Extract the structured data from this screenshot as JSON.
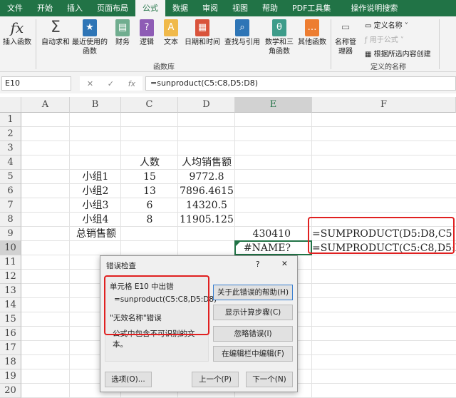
{
  "tabs": [
    "文件",
    "开始",
    "插入",
    "页面布局",
    "公式",
    "数据",
    "审阅",
    "视图",
    "帮助",
    "PDF工具集",
    "操作说明搜索"
  ],
  "ribbon": {
    "insert_fn": "插入函数",
    "autosum": "自动求和",
    "recent": "最近使用的函数",
    "finance": "财务",
    "logic": "逻辑",
    "text": "文本",
    "datetime": "日期和时间",
    "lookup": "查找与引用",
    "math": "数学和三角函数",
    "other": "其他函数",
    "group_lib": "函数库",
    "name_mgr": "名称管理器",
    "define_name": "定义名称",
    "use_formula": "用于公式",
    "create_sel": "根据所选内容创建",
    "group_names": "定义的名称"
  },
  "formula_bar": {
    "name_box": "E10",
    "formula": "=sunproduct(C5:C8,D5:D8)"
  },
  "columns": [
    "A",
    "B",
    "C",
    "D",
    "E",
    "F"
  ],
  "rows": [
    "1",
    "2",
    "3",
    "4",
    "5",
    "6",
    "7",
    "8",
    "9",
    "10",
    "11",
    "12",
    "13",
    "14",
    "15",
    "16",
    "17",
    "18",
    "19",
    "20"
  ],
  "cells": {
    "c4": "人数",
    "d4": "人均销售额",
    "b5": "小组1",
    "c5": "15",
    "d5": "9772.8",
    "b6": "小组2",
    "c6": "13",
    "d6": "7896.4615",
    "b7": "小组3",
    "c7": "6",
    "d7": "14320.5",
    "b8": "小组4",
    "c8": "8",
    "d8": "11905.125",
    "b9": "总销售额",
    "e9": "430410",
    "f9": "=SUMPRODUCT(D5:D8,C5:C8)",
    "e10": "#NAME?",
    "f10": "=SUMPRODUCT(C5:C8,D5:D8)"
  },
  "dialog": {
    "title": "错误检查",
    "help": "?",
    "close": "✕",
    "cell_error": "单元格 E10 中出错",
    "formula": "=sunproduct(C5:C8,D5:D8)",
    "error_type": "\"无效名称\"错误",
    "error_desc": "公式中包含不可识别的文本。",
    "btn_help": "关于此错误的帮助(H)",
    "btn_steps": "显示计算步骤(C)",
    "btn_ignore": "忽略错误(I)",
    "btn_edit": "在编辑栏中编辑(F)",
    "btn_options": "选项(O)...",
    "btn_prev": "上一个(P)",
    "btn_next": "下一个(N)"
  },
  "colors": {
    "excel_green": "#217346",
    "highlight_red": "#e02020"
  }
}
